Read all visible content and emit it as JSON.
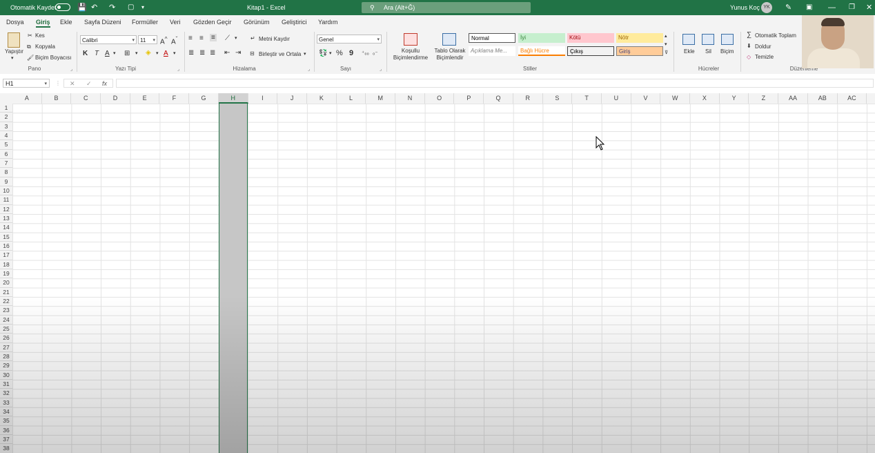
{
  "titlebar": {
    "autosave_label": "Otomatik Kaydet",
    "title": "Kitap1 - Excel",
    "search_placeholder": "Ara (Alt+Ğ)",
    "user_name": "Yunus Koç",
    "user_initials": "YK"
  },
  "menu": {
    "tabs": [
      "Dosya",
      "Giriş",
      "Ekle",
      "Sayfa Düzeni",
      "Formüller",
      "Veri",
      "Gözden Geçir",
      "Görünüm",
      "Geliştirici",
      "Yardım"
    ],
    "active_tab": "Giriş"
  },
  "ribbon": {
    "clipboard": {
      "paste": "Yapıştır",
      "cut": "Kes",
      "copy": "Kopyala",
      "format_painter": "Biçim Boyacısı",
      "label": "Pano"
    },
    "font": {
      "name": "Calibri",
      "size": "11",
      "bold": "K",
      "italic": "T",
      "underline": "A",
      "font_color": "A",
      "label": "Yazı Tipi"
    },
    "alignment": {
      "wrap": "Metni Kaydır",
      "merge": "Birleştir ve Ortala",
      "label": "Hizalama"
    },
    "number": {
      "format": "Genel",
      "percent": "%",
      "comma": "9",
      "label": "Sayı"
    },
    "styles": {
      "conditional": "Koşullu Biçimlendirme",
      "table": "Tablo Olarak Biçimlendir",
      "label": "Stiller",
      "cells": [
        {
          "text": "Normal",
          "bg": "#ffffff",
          "color": "#000000"
        },
        {
          "text": "İyi",
          "bg": "#c6efce",
          "color": "#2f7d32"
        },
        {
          "text": "Kötü",
          "bg": "#ffc7ce",
          "color": "#9c0006"
        },
        {
          "text": "Nötr",
          "bg": "#ffeb9c",
          "color": "#9c6500"
        },
        {
          "text": "Açıklama Me...",
          "bg": "#ffffff",
          "color": "#7f7f7f"
        },
        {
          "text": "Bağlı Hücre",
          "bg": "#ffffff",
          "color": "#fa7d00"
        },
        {
          "text": "Çıkış",
          "bg": "#f2f2f2",
          "color": "#3f3f3f"
        },
        {
          "text": "Giriş",
          "bg": "#ffcc99",
          "color": "#3f3f76"
        }
      ]
    },
    "cells_group": {
      "insert": "Ekle",
      "delete": "Sil",
      "format": "Biçim",
      "label": "Hücreler"
    },
    "editing": {
      "autosum": "Otomatik Toplam",
      "fill": "Doldur",
      "clear": "Temizle",
      "label": "Düzenleme"
    }
  },
  "formula_bar": {
    "name_box": "H1",
    "fx": "fx",
    "formula": ""
  },
  "grid": {
    "columns": [
      "A",
      "B",
      "C",
      "D",
      "E",
      "F",
      "G",
      "H",
      "I",
      "J",
      "K",
      "L",
      "M",
      "N",
      "O",
      "P",
      "Q",
      "R",
      "S",
      "T",
      "U",
      "V",
      "W",
      "X",
      "Y",
      "Z",
      "AA",
      "AB",
      "AC"
    ],
    "row_count": 38,
    "selected_column": "H"
  },
  "colors": {
    "accent": "#217346",
    "selection": "#c6c6c6"
  }
}
